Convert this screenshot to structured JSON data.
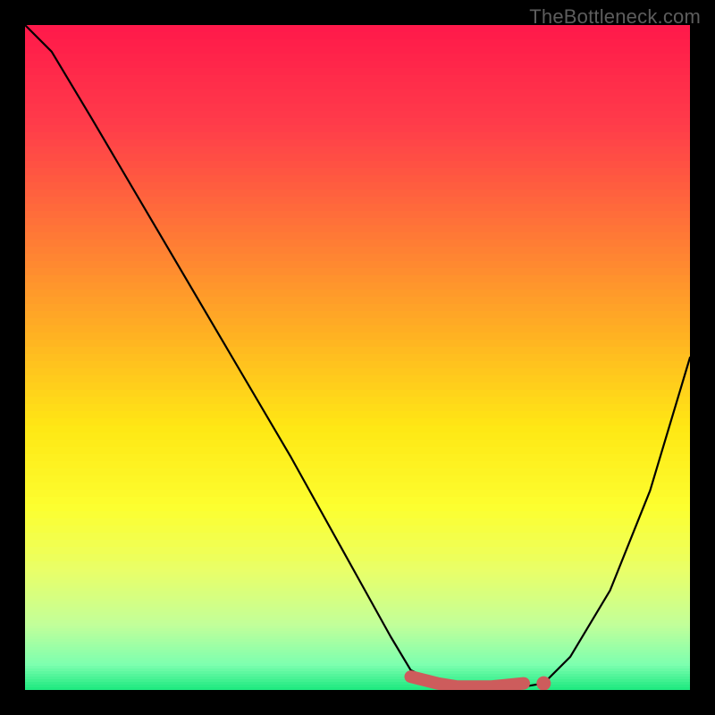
{
  "watermark": "TheBottleneck.com",
  "chart_data": {
    "type": "line",
    "title": "",
    "xlabel": "",
    "ylabel": "",
    "xlim": [
      0,
      100
    ],
    "ylim": [
      0,
      100
    ],
    "grid": false,
    "legend": false,
    "series": [
      {
        "name": "bottleneck-curve",
        "x": [
          0,
          4,
          10,
          20,
          30,
          40,
          50,
          55,
          58,
          62,
          65,
          70,
          75,
          78,
          82,
          88,
          94,
          100
        ],
        "y": [
          100,
          96,
          86,
          69,
          52,
          35,
          17,
          8,
          3,
          1,
          0.5,
          0.5,
          0.5,
          1,
          5,
          15,
          30,
          50
        ]
      }
    ],
    "highlight": {
      "name": "optimal-range",
      "x": [
        58,
        62,
        65,
        70,
        75
      ],
      "y": [
        2,
        1,
        0.5,
        0.5,
        1
      ]
    },
    "marker_point": {
      "x": 78,
      "y": 1
    },
    "background_gradient": {
      "stops": [
        {
          "pos": 0.0,
          "color": "#ff1a4b"
        },
        {
          "pos": 0.15,
          "color": "#ff3e4a"
        },
        {
          "pos": 0.3,
          "color": "#ff7538"
        },
        {
          "pos": 0.45,
          "color": "#ffae24"
        },
        {
          "pos": 0.6,
          "color": "#ffe815"
        },
        {
          "pos": 0.72,
          "color": "#fdff30"
        },
        {
          "pos": 0.82,
          "color": "#e9ff6a"
        },
        {
          "pos": 0.9,
          "color": "#c2ff9a"
        },
        {
          "pos": 0.96,
          "color": "#7dffb0"
        },
        {
          "pos": 1.0,
          "color": "#17e87c"
        }
      ]
    }
  }
}
